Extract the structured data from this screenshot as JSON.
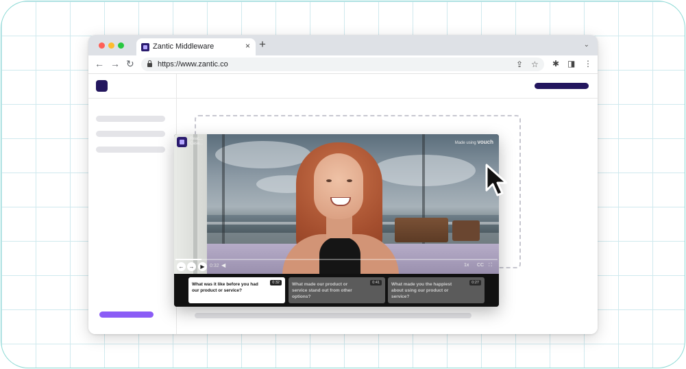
{
  "browser": {
    "traffic_lights": [
      "#ff5f57",
      "#febc2e",
      "#28c840"
    ],
    "tab": {
      "title": "Zantic Middleware",
      "close_glyph": "×"
    },
    "new_tab_glyph": "+",
    "tab_menu_glyph": "⌄",
    "nav": {
      "back": "←",
      "forward": "→",
      "reload": "↻"
    },
    "address": {
      "url": "https://www.zantic.co",
      "share_icon": "⇪",
      "bookmark_icon": "☆"
    },
    "toolbar_icons": {
      "extensions": "✱",
      "sidepanel": "◨",
      "menu": "⋮"
    }
  },
  "page": {
    "brand_color": "#23165e",
    "accent_color": "#8b5cf6"
  },
  "widget": {
    "brand_text_line1": "Reac...",
    "brand_text_line2": "Case...",
    "made_using_prefix": "Made using",
    "made_using_brand": "vouch",
    "controls": {
      "prev": "←",
      "next": "→",
      "play": "▶",
      "time": "0:32",
      "volume": "◀",
      "speed": "1x",
      "captions": "CC",
      "fullscreen": "⛶"
    },
    "progress_fraction": 0.08,
    "chapters": [
      {
        "question": "What was it like before you had our product or service?",
        "duration": "0:32",
        "active": true
      },
      {
        "question": "What made our product or service stand out from other options?",
        "duration": "0:41",
        "active": false
      },
      {
        "question": "What made you the happiest about using our product or service?",
        "duration": "0:27",
        "active": false
      }
    ]
  }
}
